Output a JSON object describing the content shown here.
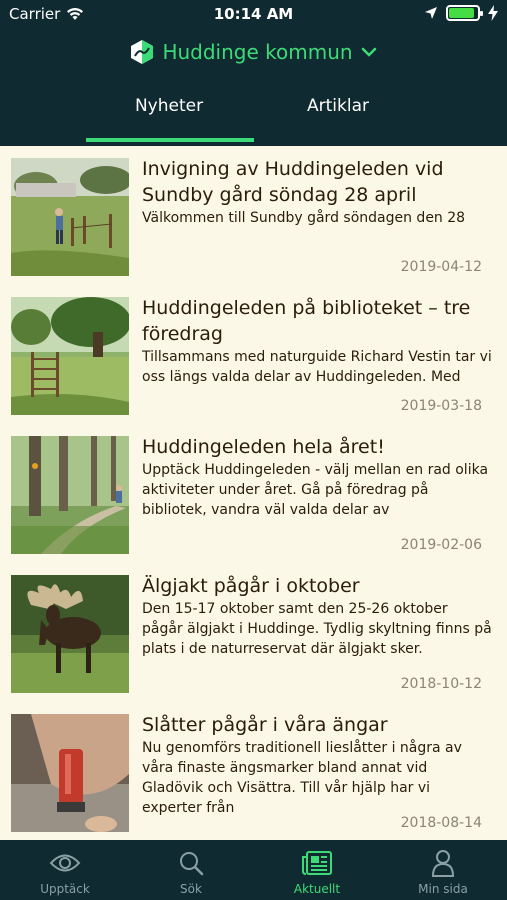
{
  "status_bar": {
    "carrier": "Carrier",
    "time": "10:14 AM",
    "battery_level": 0.9
  },
  "header": {
    "title": "Huddinge kommun",
    "tabs": [
      {
        "label": "Nyheter",
        "active": true
      },
      {
        "label": "Artiklar",
        "active": false
      }
    ]
  },
  "news": [
    {
      "title": "Invigning av Huddingeleden vid Sundby gård söndag 28 april",
      "excerpt": "Välkommen till Sundby gård söndagen den 28",
      "date": "2019-04-12",
      "image": "field-with-fence-and-person"
    },
    {
      "title": "Huddingeleden på biblioteket – tre föredrag",
      "excerpt": "Tillsammans med naturguide Richard Vestin tar vi oss längs valda delar av Huddingeleden. Med",
      "date": "2019-03-18",
      "image": "stile-and-oak-tree"
    },
    {
      "title": "Huddingeleden hela året!",
      "excerpt": "Upptäck Huddingeleden - välj mellan en rad olika aktiviteter under året. Gå på föredrag på bibliotek, vandra väl valda delar av",
      "date": "2019-02-06",
      "image": "forest-trail"
    },
    {
      "title": "Älgjakt pågår i oktober",
      "excerpt": "Den 15-17 oktober samt den 25-26 oktober pågår älgjakt i Huddinge. Tydlig skyltning finns på plats i de naturreservat där älgjakt sker.",
      "date": "2018-10-12",
      "image": "moose"
    },
    {
      "title": "Slåtter pågår i våra ängar",
      "excerpt": "Nu genomförs traditionell lieslåtter i några av våra finaste ängsmarker bland annat vid Gladövik och Visättra. Till vår hjälp har vi experter från",
      "date": "2018-08-14",
      "image": "hand-with-whetstone"
    }
  ],
  "tabbar": [
    {
      "label": "Upptäck",
      "icon": "eye-icon",
      "active": false
    },
    {
      "label": "Sök",
      "icon": "search-icon",
      "active": false
    },
    {
      "label": "Aktuellt",
      "icon": "newspaper-icon",
      "active": true
    },
    {
      "label": "Min sida",
      "icon": "person-icon",
      "active": false
    }
  ],
  "colors": {
    "header_bg": "#0f2a30",
    "accent": "#3ddb77",
    "list_bg": "#fbf8e8",
    "text": "#2b1c0c",
    "date": "#8a8577"
  }
}
